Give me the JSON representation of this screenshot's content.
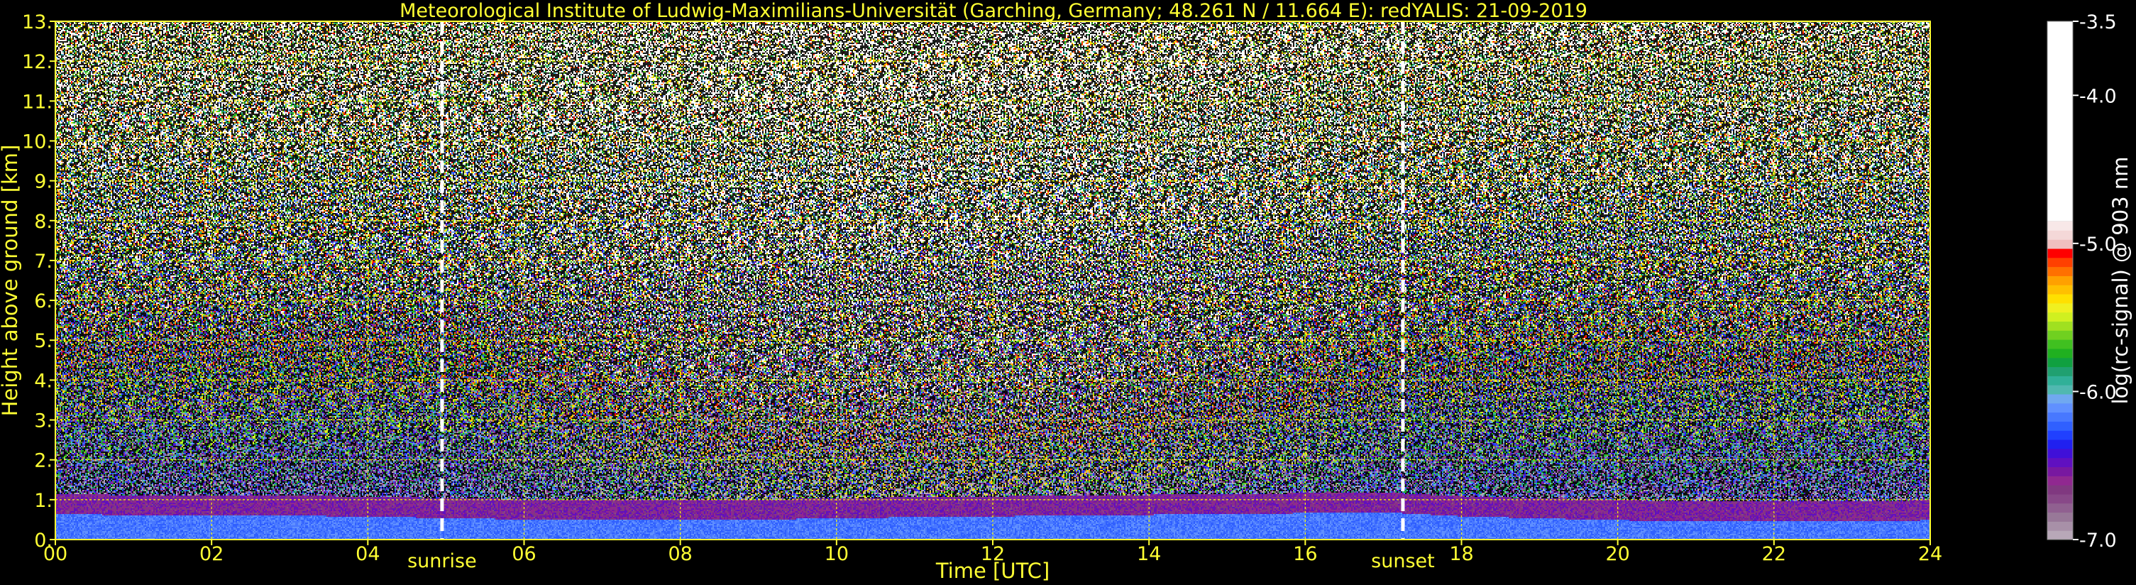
{
  "chart_data": {
    "type": "heatmap",
    "title": "Meteorological Institute of Ludwig-Maximilians-Universität (Garching, Germany; 48.261 N / 11.664 E):    redYALIS: 21-09-2019",
    "xlabel": "Time [UTC]",
    "ylabel": "Height above ground [km]",
    "xlim": [
      0,
      24
    ],
    "ylim": [
      0,
      13
    ],
    "x_ticks": [
      {
        "value": 0,
        "label": "00"
      },
      {
        "value": 2,
        "label": "02"
      },
      {
        "value": 4,
        "label": "04"
      },
      {
        "value": 6,
        "label": "06"
      },
      {
        "value": 8,
        "label": "08"
      },
      {
        "value": 10,
        "label": "10"
      },
      {
        "value": 12,
        "label": "12"
      },
      {
        "value": 14,
        "label": "14"
      },
      {
        "value": 16,
        "label": "16"
      },
      {
        "value": 18,
        "label": "18"
      },
      {
        "value": 20,
        "label": "20"
      },
      {
        "value": 22,
        "label": "22"
      },
      {
        "value": 24,
        "label": "24"
      }
    ],
    "y_ticks": [
      {
        "value": 0,
        "label": "0."
      },
      {
        "value": 1,
        "label": "1."
      },
      {
        "value": 2,
        "label": "2."
      },
      {
        "value": 3,
        "label": "3."
      },
      {
        "value": 4,
        "label": "4."
      },
      {
        "value": 5,
        "label": "5."
      },
      {
        "value": 6,
        "label": "6."
      },
      {
        "value": 7,
        "label": "7."
      },
      {
        "value": 8,
        "label": "8."
      },
      {
        "value": 9,
        "label": "9."
      },
      {
        "value": 10,
        "label": "10."
      },
      {
        "value": 11,
        "label": "11."
      },
      {
        "value": 12,
        "label": "12."
      },
      {
        "value": 13,
        "label": "13."
      }
    ],
    "grid": true,
    "grid_color": "#ffff00",
    "annotations": [
      {
        "x": 4.95,
        "label": "sunrise"
      },
      {
        "x": 17.25,
        "label": "sunset"
      }
    ],
    "colorbar": {
      "label": "log(rc-signal) @ 903 nm",
      "range": [
        -7.0,
        -3.5
      ],
      "ticks": [
        {
          "value": -3.5,
          "label": "-3.5"
        },
        {
          "value": -4.0,
          "label": "-4.0"
        },
        {
          "value": -5.0,
          "label": "-5.0"
        },
        {
          "value": -6.0,
          "label": "-6.0"
        },
        {
          "value": -7.0,
          "label": "-7.0"
        }
      ],
      "colors": [
        "#b8a8b8",
        "#a890a8",
        "#987898",
        "#906090",
        "#884888",
        "#803880",
        "#902890",
        "#7818a0",
        "#6010c0",
        "#4010d8",
        "#2020f0",
        "#2040ff",
        "#3060ff",
        "#4878ff",
        "#6090ff",
        "#70a8f0",
        "#50b8b0",
        "#30b098",
        "#20a070",
        "#10a040",
        "#20b020",
        "#40c020",
        "#70d020",
        "#a0e020",
        "#d0f020",
        "#f0f020",
        "#ffe000",
        "#ffc000",
        "#ffa000",
        "#ff7000",
        "#ff4000",
        "#ff0000",
        "#f0c0c0",
        "#f4d8d8",
        "#f8e8e8",
        "#ffffff"
      ]
    },
    "signal_regime": {
      "boundary_layer_top_km": [
        {
          "t": 0,
          "h": 0.65
        },
        {
          "t": 2,
          "h": 0.62
        },
        {
          "t": 4,
          "h": 0.6
        },
        {
          "t": 5,
          "h": 0.55
        },
        {
          "t": 7,
          "h": 0.5
        },
        {
          "t": 9,
          "h": 0.52
        },
        {
          "t": 11,
          "h": 0.58
        },
        {
          "t": 13,
          "h": 0.62
        },
        {
          "t": 15,
          "h": 0.66
        },
        {
          "t": 17,
          "h": 0.7
        },
        {
          "t": 18,
          "h": 0.6
        },
        {
          "t": 20,
          "h": 0.5
        },
        {
          "t": 22,
          "h": 0.48
        },
        {
          "t": 24,
          "h": 0.5
        }
      ]
    }
  }
}
